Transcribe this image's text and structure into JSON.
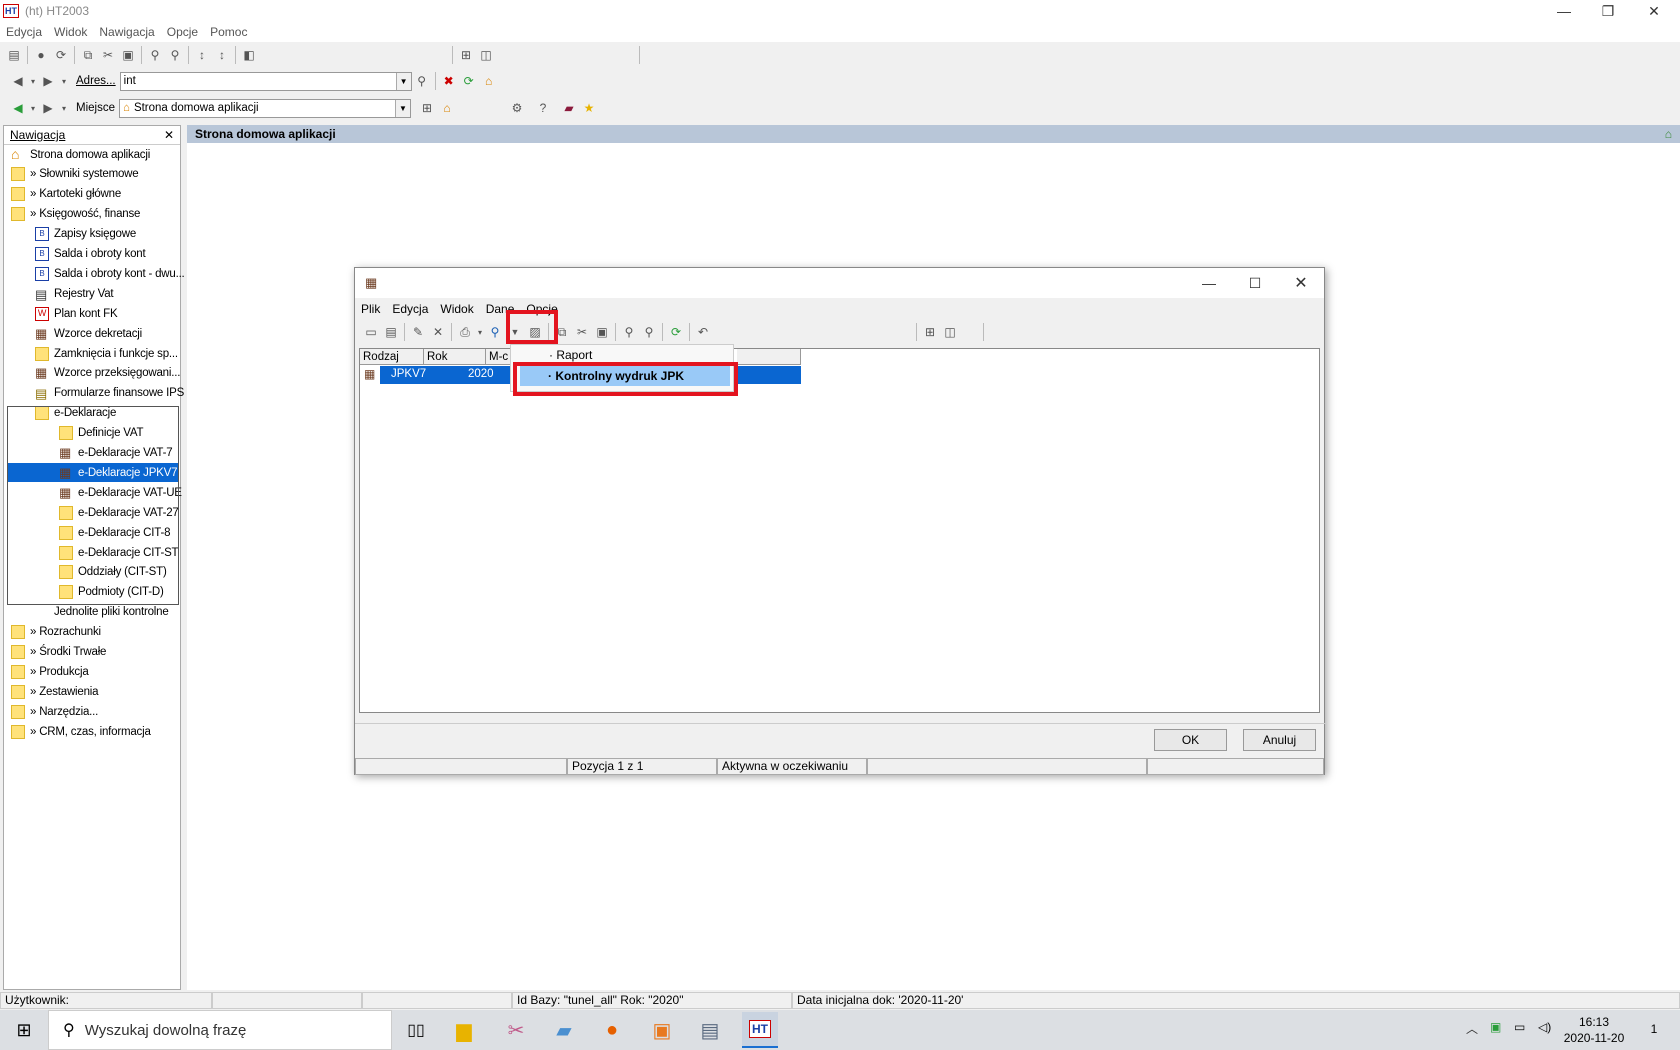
{
  "window": {
    "title": "(ht)  HT2003",
    "logo": "HT"
  },
  "menu": [
    "Edycja",
    "Widok",
    "Nawigacja",
    "Opcje",
    "Pomoc"
  ],
  "address": {
    "label": "Adres...",
    "value": "int"
  },
  "location": {
    "label": "Miejsce",
    "value": "Strona domowa aplikacji"
  },
  "nav": {
    "title": "Nawigacja",
    "close": "✕",
    "items": [
      {
        "label": "Strona domowa aplikacji",
        "icon": "home-icon"
      },
      {
        "label": "» Słowniki systemowe",
        "icon": "folder-icon"
      },
      {
        "label": "» Kartoteki główne",
        "icon": "folder-icon"
      },
      {
        "label": "» Księgowość, finanse",
        "icon": "folder-icon"
      },
      {
        "label": "Zapisy księgowe",
        "icon": "ledger-icon"
      },
      {
        "label": "Salda i obroty kont",
        "icon": "ledger-icon"
      },
      {
        "label": "Salda i obroty kont - dwu...",
        "icon": "ledger-icon"
      },
      {
        "label": "Rejestry Vat",
        "icon": "register-icon"
      },
      {
        "label": "Plan kont FK",
        "icon": "plan-icon"
      },
      {
        "label": "Wzorce dekretacji",
        "icon": "table-icon"
      },
      {
        "label": "Zamknięcia i funkcje sp...",
        "icon": "folder-icon"
      },
      {
        "label": "Wzorce przeksięgowani...",
        "icon": "table-icon"
      },
      {
        "label": "Formularze finansowe IPS",
        "icon": "form-icon"
      },
      {
        "label": "e-Deklaracje",
        "icon": "folder-icon"
      },
      {
        "label": "Definicje VAT",
        "icon": "folder-icon"
      },
      {
        "label": "e-Deklaracje VAT-7",
        "icon": "table-icon"
      },
      {
        "label": "e-Deklaracje JPKV7",
        "icon": "table-icon"
      },
      {
        "label": "e-Deklaracje VAT-UE",
        "icon": "table-icon"
      },
      {
        "label": "e-Deklaracje VAT-27",
        "icon": "folder-icon"
      },
      {
        "label": "e-Deklaracje CIT-8",
        "icon": "folder-icon"
      },
      {
        "label": "e-Deklaracje CIT-ST",
        "icon": "folder-icon"
      },
      {
        "label": "Oddziały (CIT-ST)",
        "icon": "folder-icon"
      },
      {
        "label": "Podmioty (CIT-D)",
        "icon": "folder-icon"
      },
      {
        "label": "Jednolite pliki kontrolne",
        "icon": "none"
      },
      {
        "label": "» Rozrachunki",
        "icon": "folder-icon"
      },
      {
        "label": "» Środki Trwałe",
        "icon": "folder-icon"
      },
      {
        "label": "» Produkcja",
        "icon": "folder-icon"
      },
      {
        "label": "» Zestawienia",
        "icon": "folder-icon"
      },
      {
        "label": "» Narzędzia...",
        "icon": "folder-icon"
      },
      {
        "label": "» CRM, czas, informacja",
        "icon": "folder-icon"
      }
    ]
  },
  "main": {
    "title": "Strona domowa aplikacji"
  },
  "dialog": {
    "menu": [
      "Plik",
      "Edycja",
      "Widok",
      "Dane",
      "Opcje"
    ],
    "columns": [
      "Rodzaj",
      "Rok",
      "M-c"
    ],
    "row": {
      "rodzaj": "JPKV7",
      "rok": "2020"
    },
    "dropdown": {
      "item1": "· Raport",
      "item2": "· Kontrolny wydruk JPK"
    },
    "ok": "OK",
    "cancel": "Anuluj",
    "status": {
      "position": "Pozycja 1 z 1",
      "state": "Aktywna w oczekiwaniu"
    }
  },
  "statusbar": {
    "user": "Użytkownik:",
    "db": "Id Bazy: \"tunel_all\" Rok: \"2020\"",
    "date": "Data inicjalna dok: '2020-11-20'"
  },
  "taskbar": {
    "search_placeholder": "Wyszukaj dowolną frazę",
    "time": "16:13",
    "date": "2020-11-20",
    "notif": "1"
  },
  "colors": {
    "selection": "#0a66d1",
    "highlight": "#e3141f",
    "menu_hover": "#99c9f7"
  }
}
